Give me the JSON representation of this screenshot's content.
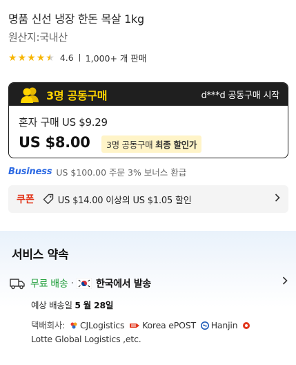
{
  "product": {
    "title": "명품 신선 냉장 한돈 목살 1kg",
    "origin": "원산지:국내산",
    "rating": "4.6",
    "sales": "1,000+ 개 판매"
  },
  "group_buy": {
    "label": "3명 공동구매",
    "starter": "d***d 공동구매 시작",
    "solo_price": "혼자 구매 US $9.29",
    "group_price": "US $8.00",
    "badge_prefix": "3명 공동구매 ",
    "badge_emphasis": "최종 할인가"
  },
  "business": {
    "logo": "Business",
    "text": "US $100.00 주문 3% 보너스 환급"
  },
  "coupon": {
    "label": "쿠폰",
    "text": "US $14.00 이상의 US $1.05 할인"
  },
  "service": {
    "title": "서비스 약속",
    "free_shipping": "무료 배송",
    "separator": "·",
    "ships_from": "한국에서 발송",
    "eta_prefix": "예상 배송일 ",
    "eta_date": "5 월 28일",
    "carrier_label": "택배회사:",
    "carriers": [
      "CJLogistics",
      "Korea ePOST",
      "Hanjin",
      "Lotte Global Logistics ,etc."
    ]
  },
  "colors": {
    "accent_yellow": "#ffd400",
    "coupon_red": "#e2361b",
    "free_green": "#1f9e3a",
    "business_blue": "#2d6ae3",
    "badge_bg": "#fff4c8"
  }
}
